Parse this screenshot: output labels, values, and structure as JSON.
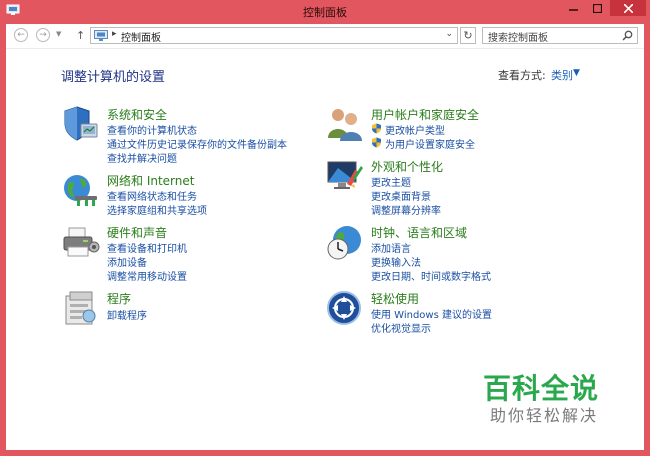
{
  "window": {
    "title": "控制面板"
  },
  "nav": {
    "address": "控制面板",
    "search_placeholder": "搜索控制面板"
  },
  "main": {
    "heading": "调整计算机的设置",
    "view_by_label": "查看方式:",
    "view_by_value": "类别"
  },
  "categories": [
    {
      "title": "系统和安全",
      "links": [
        "查看你的计算机状态",
        "通过文件历史记录保存你的文件备份副本",
        "查找并解决问题"
      ]
    },
    {
      "title": "网络和 Internet",
      "links": [
        "查看网络状态和任务",
        "选择家庭组和共享选项"
      ]
    },
    {
      "title": "硬件和声音",
      "links": [
        "查看设备和打印机",
        "添加设备",
        "调整常用移动设置"
      ]
    },
    {
      "title": "程序",
      "links": [
        "卸载程序"
      ]
    },
    {
      "title": "用户帐户和家庭安全",
      "links": [
        "更改帐户类型",
        "为用户设置家庭安全"
      ]
    },
    {
      "title": "外观和个性化",
      "links": [
        "更改主题",
        "更改桌面背景",
        "调整屏幕分辨率"
      ]
    },
    {
      "title": "时钟、语言和区域",
      "links": [
        "添加语言",
        "更换输入法",
        "更改日期、时间或数字格式"
      ]
    },
    {
      "title": "轻松使用",
      "links": [
        "使用 Windows 建议的设置",
        "优化视觉显示"
      ]
    }
  ],
  "watermark": {
    "title": "百科全说",
    "subtitle": "助你轻松解决"
  },
  "colors": {
    "frame": "#e2575f",
    "close": "#c7333c",
    "category_title": "#2a7d1b",
    "link": "#1a4fa3",
    "heading": "#1e3287",
    "watermark": "#2aa84e"
  }
}
